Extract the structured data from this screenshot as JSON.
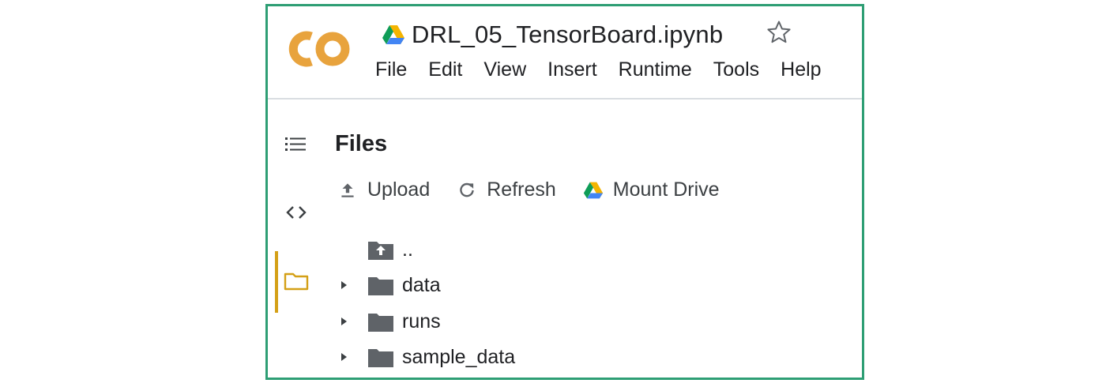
{
  "notebook": {
    "app_logo_text": "CO",
    "title": "DRL_05_TensorBoard.ipynb",
    "star_icon": "star-outline-icon",
    "drive_icon": "google-drive-icon"
  },
  "menu": [
    {
      "label": "File"
    },
    {
      "label": "Edit"
    },
    {
      "label": "View"
    },
    {
      "label": "Insert"
    },
    {
      "label": "Runtime"
    },
    {
      "label": "Tools"
    },
    {
      "label": "Help"
    }
  ],
  "sidebar": {
    "icons": [
      "table-of-contents-icon",
      "code-snippets-icon",
      "files-folder-icon"
    ],
    "active": "files-folder-icon"
  },
  "files_panel": {
    "title": "Files",
    "actions": [
      {
        "label": "Upload",
        "icon": "upload-icon"
      },
      {
        "label": "Refresh",
        "icon": "refresh-icon"
      },
      {
        "label": "Mount Drive",
        "icon": "google-drive-icon"
      }
    ],
    "entries": [
      {
        "name": "..",
        "type": "parent-folder"
      },
      {
        "name": "data",
        "type": "folder"
      },
      {
        "name": "runs",
        "type": "folder"
      },
      {
        "name": "sample_data",
        "type": "folder"
      }
    ]
  },
  "colors": {
    "frame_border": "#2e9e74",
    "logo_orange": "#e8a33d",
    "active_rail": "#d4a017",
    "folder_gray": "#5f6368"
  }
}
